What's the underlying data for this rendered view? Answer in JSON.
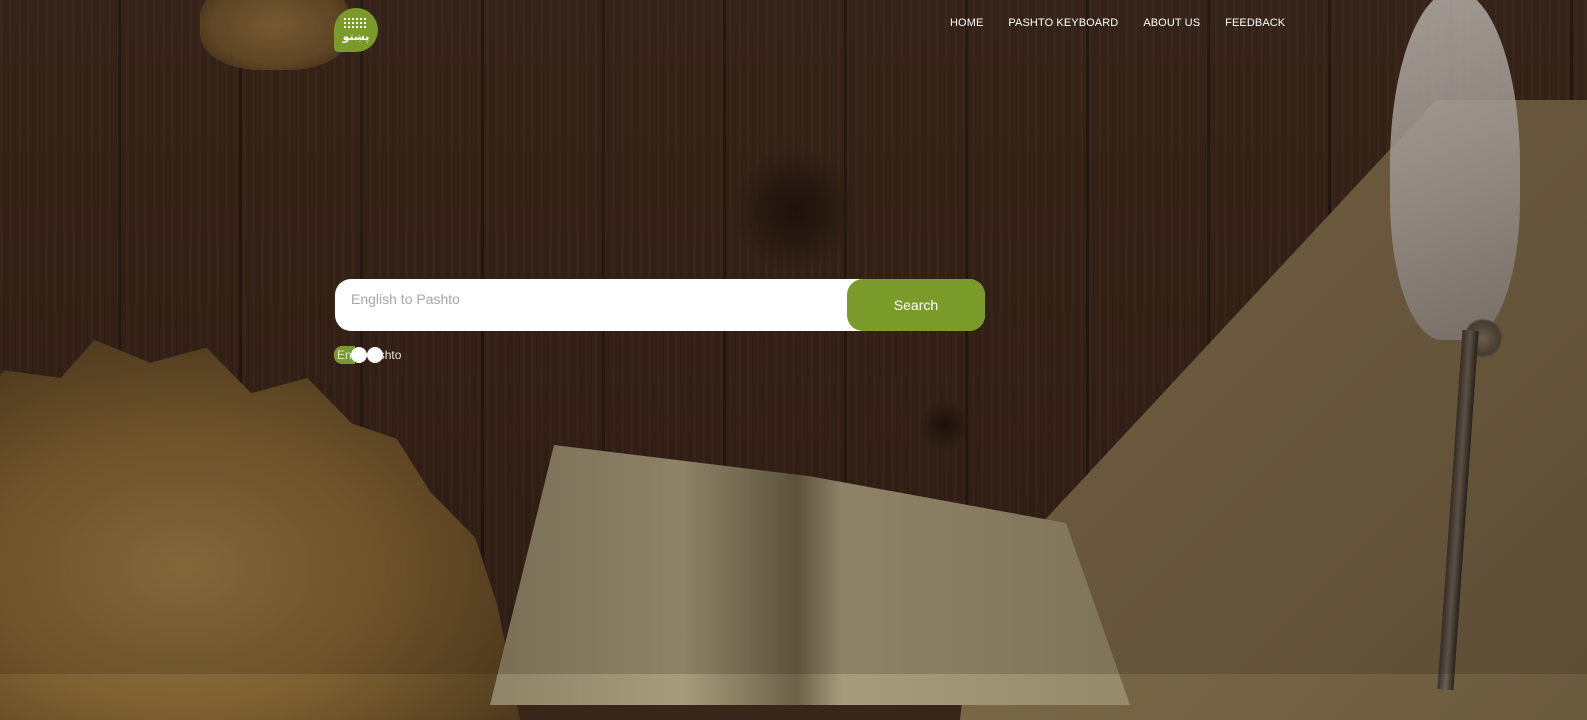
{
  "logo": {
    "text": "پښتو",
    "icon": "keyboard-icon"
  },
  "nav": {
    "items": [
      {
        "label": "HOME"
      },
      {
        "label": "PASHTO KEYBOARD"
      },
      {
        "label": "ABOUT US"
      },
      {
        "label": "FEEDBACK"
      }
    ]
  },
  "search": {
    "placeholder": "English to Pashto",
    "value": "",
    "button_label": "Search"
  },
  "toggle": {
    "left_label": "En",
    "right_label": "shto"
  },
  "colors": {
    "accent": "#7a9a2a",
    "nav_text": "#ffffff",
    "background": "#3a2519"
  }
}
